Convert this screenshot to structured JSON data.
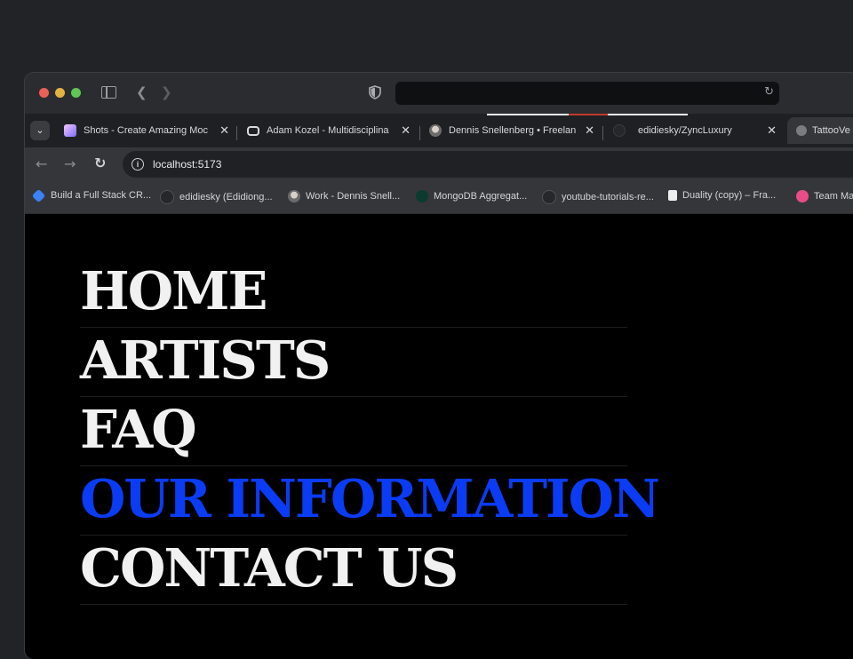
{
  "browser": {
    "tabs": [
      {
        "title": "Shots - Create Amazing Moc",
        "favicon_color": "#c9c2ff"
      },
      {
        "title": "Adam Kozel - Multidisciplina",
        "favicon_color": "#d8d9dc"
      },
      {
        "title": "Dennis Snellenberg • Freelan",
        "favicon_color": "#8a8a8a"
      },
      {
        "title": "edidiesky/ZyncLuxury",
        "favicon_color": "#2f3033"
      },
      {
        "title": "TattooVe",
        "favicon_color": "#7a7c80"
      }
    ],
    "close_glyph": "✕",
    "url": "localhost:5173",
    "bookmarks": [
      {
        "label": "Build a Full Stack CR...",
        "color": "#3b82f6"
      },
      {
        "label": "edidiesky (Edidiong...",
        "color": "#2a2b2e"
      },
      {
        "label": "Work - Dennis Snell...",
        "color": "#9a9a9a"
      },
      {
        "label": "MongoDB Aggregat...",
        "color": "#00684a"
      },
      {
        "label": "youtube-tutorials-re...",
        "color": "#2a2b2e"
      },
      {
        "label": "Duality (copy) – Fra...",
        "color": "#eeeeee"
      },
      {
        "label": "Team Ma",
        "color": "#ea4c89"
      }
    ]
  },
  "menu": {
    "items": [
      "HOME",
      "ARTISTS",
      "FAQ",
      "OUR INFORMATION",
      "CONTACT US"
    ],
    "active_index": 3,
    "active_color": "#0a3cf5"
  }
}
